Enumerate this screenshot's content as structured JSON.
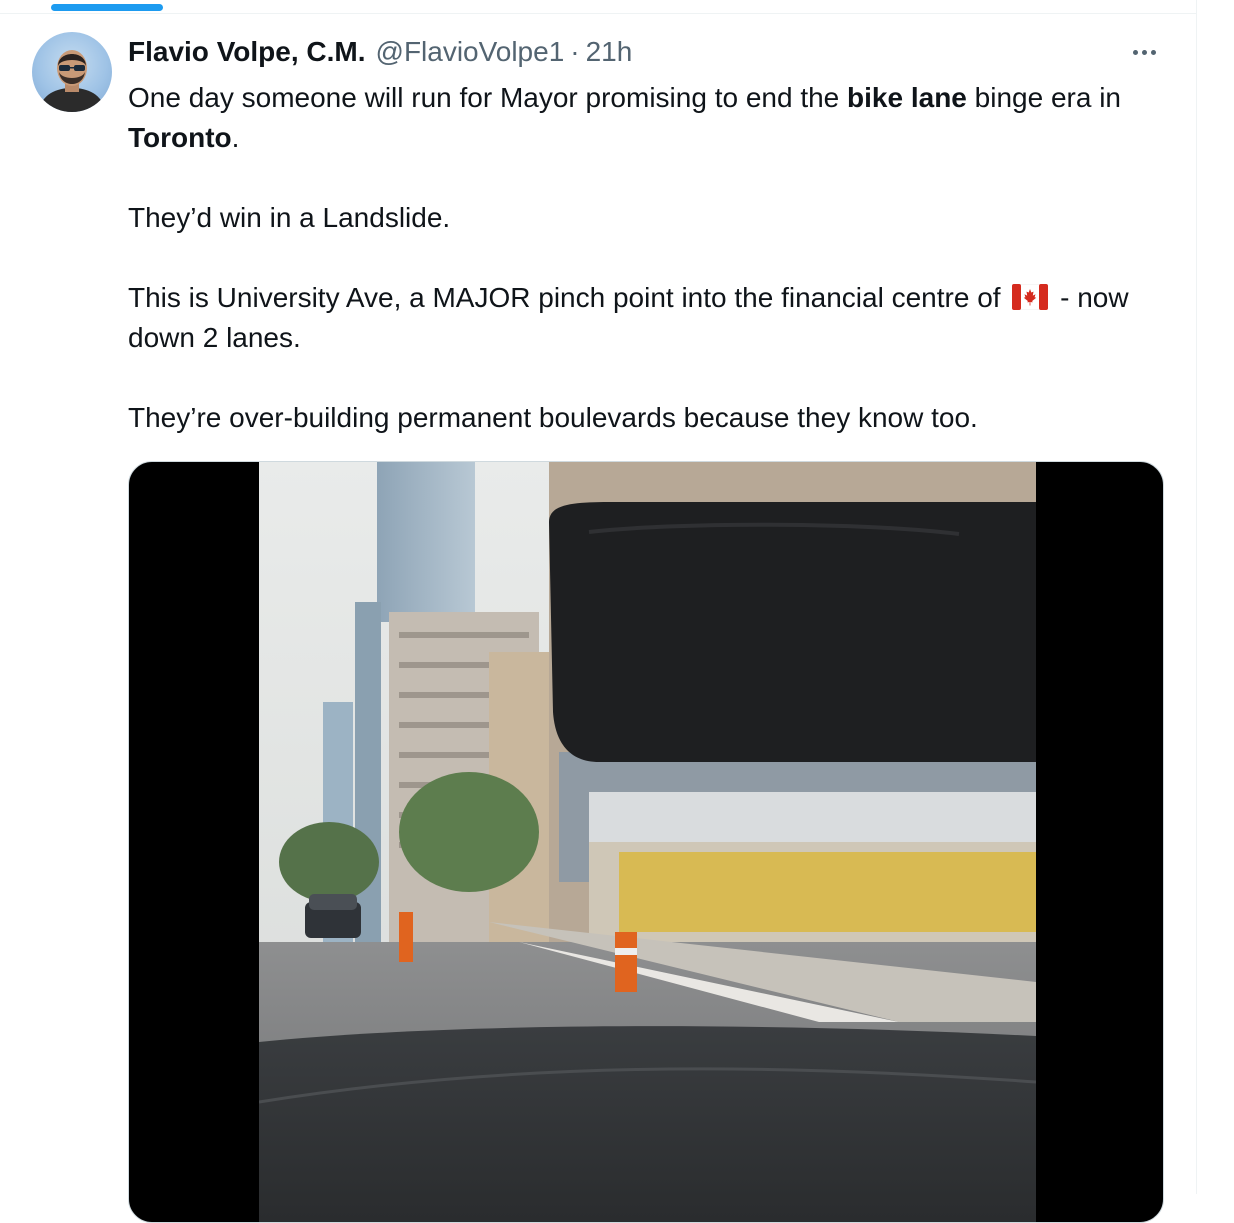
{
  "tweet": {
    "author": {
      "display_name": "Flavio Volpe, C.M.",
      "handle": "@FlavioVolpe1",
      "avatar_icon": "profile-photo-icon"
    },
    "separator": "·",
    "timestamp": "21h",
    "more_icon": "more-options-icon",
    "text": {
      "p1_a": "One day someone will run for Mayor promising to end the ",
      "p1_bold1": "bike lane",
      "p1_b": " binge era in ",
      "p1_bold2": "Toronto",
      "p1_c": ".",
      "p2": "They’d win in a Landslide.",
      "p3_a": "This is University Ave, a MAJOR pinch point into the financial centre of ",
      "p3_flag": "canada-flag-icon",
      "p3_b": " - now down 2 lanes.",
      "p4": "They’re over-building permanent boulevards because they know too."
    },
    "media": {
      "type": "video",
      "description_icon": "video-thumbnail"
    }
  },
  "colors": {
    "text_primary": "#0f1419",
    "text_secondary": "#536471",
    "accent": "#1d9bf0",
    "border": "#cfd9de"
  }
}
